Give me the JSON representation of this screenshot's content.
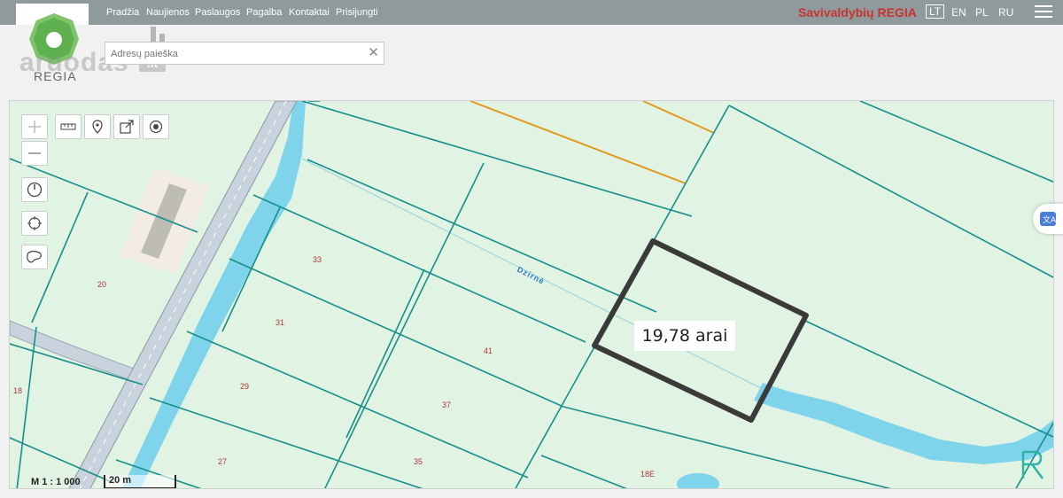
{
  "nav": {
    "items": [
      "Pradžia",
      "Naujienos",
      "Paslaugos",
      "Pagalba",
      "Kontaktai",
      "Prisijungti"
    ],
    "brand": "Savivaldybių REGIA",
    "languages": [
      "LT",
      "EN",
      "PL",
      "RU"
    ],
    "active_language": "LT",
    "menu_icon": "hamburger-icon"
  },
  "logo": {
    "text": "aruodas",
    "suffix": ".lt",
    "subtitle": "REGIA"
  },
  "search": {
    "placeholder": "Adresų paieška",
    "value": "",
    "clear_icon": "close-icon"
  },
  "map": {
    "tools": {
      "top_row": [
        "zoom-in-icon",
        "ruler-icon",
        "marker-icon",
        "share-icon",
        "locate-icon"
      ],
      "left_column": [
        "zoom-out-icon",
        "history-icon",
        "crosshair-icon",
        "lasso-icon"
      ]
    },
    "parcel_numbers": [
      "33",
      "31",
      "29",
      "27",
      "41",
      "37",
      "35",
      "20",
      "18",
      "18E"
    ],
    "street_name": "Dzirnė",
    "area_label": "19,78 arai",
    "scale": {
      "ratio": "M 1 : 1 000",
      "bar": "20 m"
    },
    "colors": {
      "background": "#e1f3e3",
      "parcel_line": "#168f8a",
      "river": "#7fd3eb",
      "road": "#c9d3dd",
      "highlight": "#3a3a3a",
      "power_line": "#e29a1c",
      "label": "#a83a3a"
    }
  }
}
